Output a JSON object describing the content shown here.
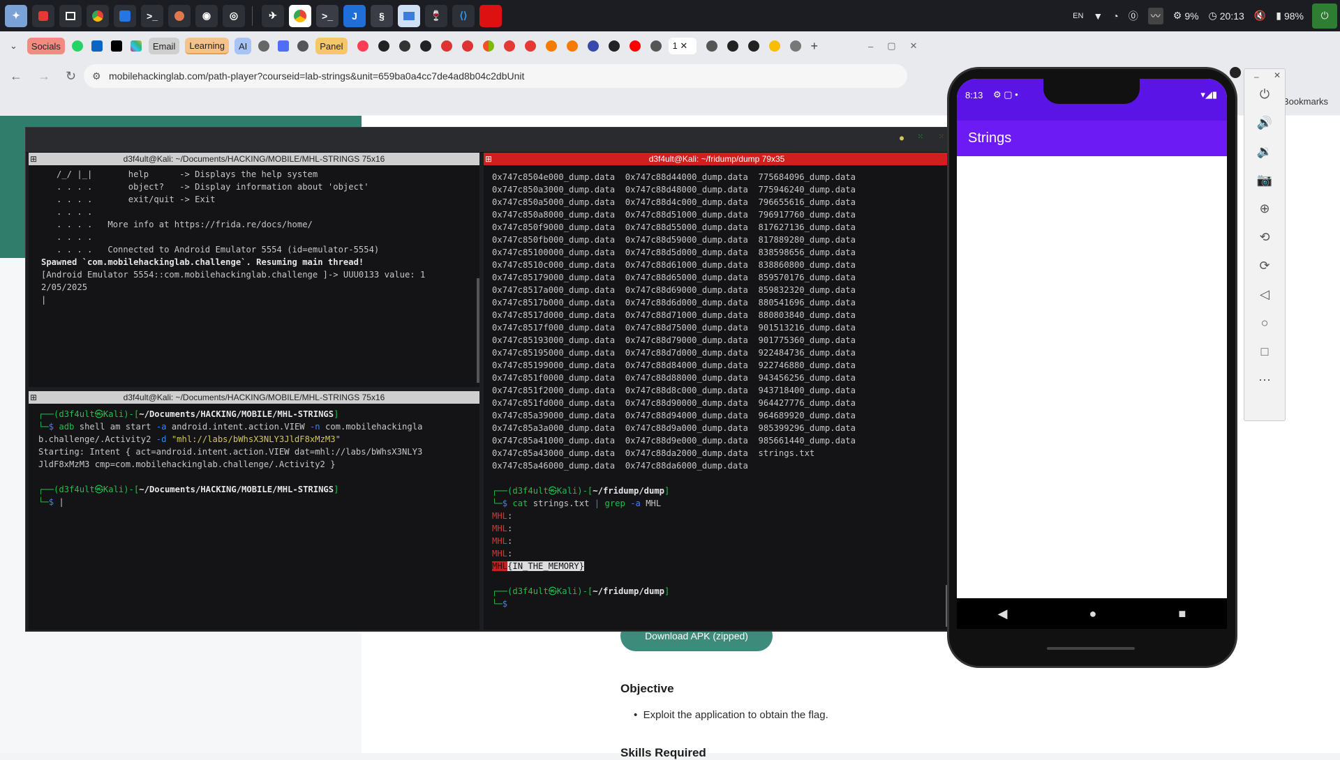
{
  "taskbar": {
    "tray": {
      "lang": "EN",
      "cpu": "9%",
      "clock": "20:13",
      "battery": "98%"
    }
  },
  "browser": {
    "bookmarks": [
      {
        "label": "Socials",
        "color": "#f28b82"
      },
      {
        "label": "Email",
        "color": "#cfcfcf"
      },
      {
        "label": "Learning",
        "color": "#f6c28b"
      },
      {
        "label": "AI",
        "color": "#a8c3f5"
      },
      {
        "label": "Panel",
        "color": "#f6c66b"
      }
    ],
    "url": "mobilehackinglab.com/path-player?courseid=lab-strings&unit=659ba0a4cc7de4ad8b04c2dbUnit",
    "bookmarks_label": "Bookmarks"
  },
  "page": {
    "download_label": "Download APK (zipped)",
    "objective_title": "Objective",
    "objective_item": "Exploit the application to obtain the flag.",
    "skills_title": "Skills Required"
  },
  "terminal": {
    "pane1_title": "d3f4ult@Kali: ~/Documents/HACKING/MOBILE/MHL-STRINGS 75x16",
    "pane2_title": "d3f4ult@Kali: ~/Documents/HACKING/MOBILE/MHL-STRINGS 75x16",
    "pane3_title": "d3f4ult@Kali: ~/fridump/dump 79x35",
    "frida_lines": [
      "   /_/ |_|       help      -> Displays the help system",
      "   . . . .       object?   -> Display information about 'object'",
      "   . . . .       exit/quit -> Exit",
      "   . . . .",
      "   . . . .   More info at https://frida.re/docs/home/",
      "   . . . .",
      "   . . . .   Connected to Android Emulator 5554 (id=emulator-5554)"
    ],
    "frida_spawned": "Spawned `com.mobilehackinglab.challenge`. Resuming main thread!",
    "frida_value": "[Android Emulator 5554::com.mobilehackinglab.challenge ]-> UUU0133 value: 1",
    "frida_value2": "2/05/2025",
    "prompt_user": "(d3f4ult㉿Kali)",
    "prompt_dir": "~/Documents/HACKING/MOBILE/MHL-STRINGS",
    "adb_cmd": "adb",
    "adb_rest": "shell am start",
    "adb_flag": "-a",
    "adb_action": "android.intent.action.VIEW",
    "adb_flag2": "-n",
    "adb_comp": "com.mobilehackingla",
    "adb_comp2": "b.challenge/.Activity2",
    "adb_flag3": "-d",
    "adb_uri": "\"mhl://labs/bWhsX3NLY3JldF8xMzM3\"",
    "adb_out1": "Starting: Intent { act=android.intent.action.VIEW dat=mhl://labs/bWhsX3NLY3",
    "adb_out2": "JldF8xMzM3 cmp=com.mobilehackinglab.challenge/.Activity2 }",
    "dump_lines": [
      "0x747c8504e000_dump.data  0x747c88d44000_dump.data  775684096_dump.data",
      "0x747c850a3000_dump.data  0x747c88d48000_dump.data  775946240_dump.data",
      "0x747c850a5000_dump.data  0x747c88d4c000_dump.data  796655616_dump.data",
      "0x747c850a8000_dump.data  0x747c88d51000_dump.data  796917760_dump.data",
      "0x747c850f9000_dump.data  0x747c88d55000_dump.data  817627136_dump.data",
      "0x747c850fb000_dump.data  0x747c88d59000_dump.data  817889280_dump.data",
      "0x747c85100000_dump.data  0x747c88d5d000_dump.data  838598656_dump.data",
      "0x747c8510c000_dump.data  0x747c88d61000_dump.data  838860800_dump.data",
      "0x747c85179000_dump.data  0x747c88d65000_dump.data  859570176_dump.data",
      "0x747c8517a000_dump.data  0x747c88d69000_dump.data  859832320_dump.data",
      "0x747c8517b000_dump.data  0x747c88d6d000_dump.data  880541696_dump.data",
      "0x747c8517d000_dump.data  0x747c88d71000_dump.data  880803840_dump.data",
      "0x747c8517f000_dump.data  0x747c88d75000_dump.data  901513216_dump.data",
      "0x747c85193000_dump.data  0x747c88d79000_dump.data  901775360_dump.data",
      "0x747c85195000_dump.data  0x747c88d7d000_dump.data  922484736_dump.data",
      "0x747c85199000_dump.data  0x747c88d84000_dump.data  922746880_dump.data",
      "0x747c851f0000_dump.data  0x747c88d88000_dump.data  943456256_dump.data",
      "0x747c851f2000_dump.data  0x747c88d8c000_dump.data  943718400_dump.data",
      "0x747c851fd000_dump.data  0x747c88d90000_dump.data  964427776_dump.data",
      "0x747c85a39000_dump.data  0x747c88d94000_dump.data  964689920_dump.data",
      "0x747c85a3a000_dump.data  0x747c88d9a000_dump.data  985399296_dump.data",
      "0x747c85a41000_dump.data  0x747c88d9e000_dump.data  985661440_dump.data",
      "0x747c85a43000_dump.data  0x747c88da2000_dump.data  strings.txt",
      "0x747c85a46000_dump.data  0x747c88da6000_dump.data"
    ],
    "dump_dir": "~/fridump/dump",
    "cat_cmd": "cat",
    "cat_arg": "strings.txt",
    "cat_pipe": "|",
    "grep_cmd": "grep",
    "grep_flag": "-a",
    "grep_arg": "MHL",
    "mhl": "MHL",
    "mhl_colon": ":",
    "flag_body": "{IN_THE_MEMORY}"
  },
  "phone": {
    "time": "8:13",
    "app_title": "Strings"
  }
}
